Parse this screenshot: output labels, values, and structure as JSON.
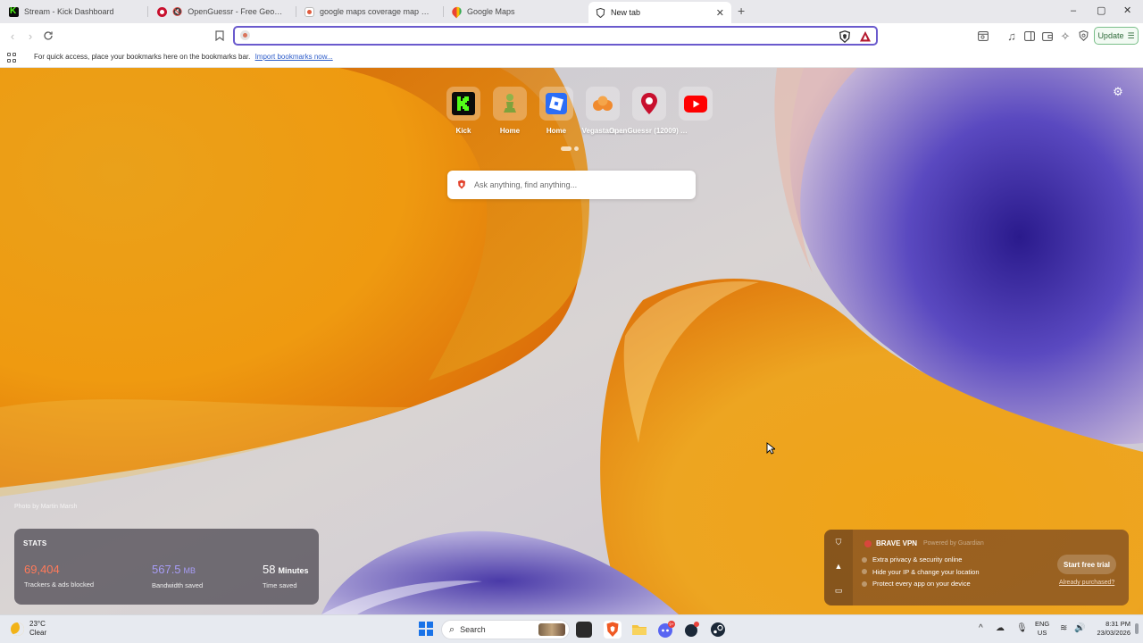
{
  "tabs": [
    {
      "title": "Stream - Kick Dashboard",
      "favicon": "kick-icon",
      "active": false
    },
    {
      "title": "OpenGuessr - Free GeoGuessr Alternative",
      "favicon": "openguessr-icon",
      "active": false
    },
    {
      "title": "google maps coverage map world - Brave Search",
      "favicon": "brave-search-icon",
      "active": false
    },
    {
      "title": "Google Maps",
      "favicon": "google-maps-icon",
      "active": false
    },
    {
      "title": "New tab",
      "favicon": "brave-shield-icon",
      "active": true
    }
  ],
  "window_controls": {
    "new_tab": "+",
    "minimize": "–",
    "maximize": "▢",
    "close": "✕"
  },
  "toolbar": {
    "address_value": "",
    "update_label": "Update"
  },
  "bookmarks_bar": {
    "message": "For quick access, place your bookmarks here on the bookmarks bar.",
    "import_link": "Import bookmarks now..."
  },
  "top_sites": [
    {
      "label": "Kick",
      "icon": "kick-icon",
      "color": "#53fc18"
    },
    {
      "label": "Home",
      "icon": "chess-pawn-icon",
      "color": "#8fb34a"
    },
    {
      "label": "Home",
      "icon": "roblox-icon",
      "color": "#2b6df6"
    },
    {
      "label": "Vegastars ...",
      "icon": "vegastars-icon",
      "color": "#f08a2e"
    },
    {
      "label": "OpenGuessr (12009) Yo...",
      "icon": "openguessr-icon",
      "color": "#c8102e"
    },
    {
      "label": "",
      "icon": "youtube-icon",
      "color": "#ff0000"
    }
  ],
  "ntp_search": {
    "placeholder": "Ask anything, find anything..."
  },
  "photo_credit": "Photo by Martin Marsh",
  "stats": {
    "title": "STATS",
    "trackers_value": "69,404",
    "trackers_label": "Trackers & ads blocked",
    "bandwidth_value": "567.5",
    "bandwidth_unit": "MB",
    "bandwidth_label": "Bandwidth saved",
    "time_value": "58",
    "time_unit": "Minutes",
    "time_label": "Time saved",
    "colors": {
      "trackers": "#ff7a5a",
      "bandwidth": "#a79cf5",
      "time": "#ffffff"
    }
  },
  "vpn": {
    "title": "BRAVE VPN",
    "powered_by": "Powered by Guardian",
    "features": [
      "Extra privacy & security online",
      "Hide your IP & change your location",
      "Protect every app on your device"
    ],
    "cta": "Start free trial",
    "purchased_link": "Already purchased?"
  },
  "taskbar": {
    "weather_temp": "23°C",
    "weather_desc": "Clear",
    "search_label": "Search",
    "lang_1": "ENG",
    "lang_2": "US",
    "time": "8:31 PM",
    "date": "23/03/2026",
    "discord_badge": "9+"
  }
}
